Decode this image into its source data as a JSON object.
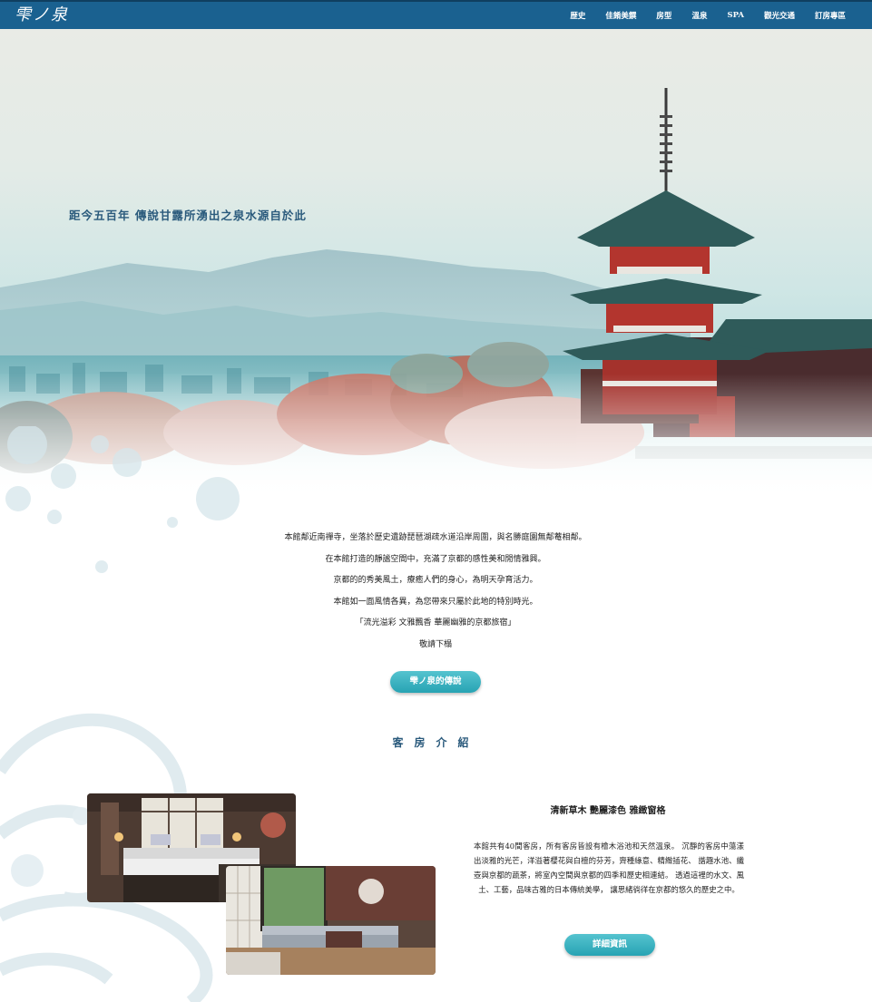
{
  "header": {
    "logo": "雫ノ泉",
    "nav": [
      "歴史",
      "佳餚美饌",
      "房型",
      "溫泉",
      "SPA",
      "觀光交通",
      "訂房專區"
    ]
  },
  "hero": {
    "tagline": "距今五百年  傳說甘露所湧出之泉水源自於此"
  },
  "intro": {
    "lines": [
      "本館鄰近南禪寺，坐落於歷史遺跡琵琶湖疏水道沿岸周圍，與名勝庭園無鄰菴相鄰。",
      "在本館打造的靜謐空間中，充滿了京都的感性美和閒情雅興。",
      "京都的的秀美風土，療癒人們的身心，為明天孕育活力。",
      "本館如一面風情各異，為您帶來只屬於此地的特別時光。",
      "「流光溢彩 文雅飄香 華麗幽雅的京都旅宿」",
      "敬請下榻"
    ],
    "button": "雫ノ泉的傳說"
  },
  "rooms": {
    "section_title": "客房介紹",
    "heading": "清新草木 艷麗漆色 雅緻窗格",
    "description": "本館共有40間客房，所有客房皆設有檜木浴池和天然溫泉。 沉靜的客房中蕩漾出淡雅的光芒，洋溢著櫻花與白檀的芬芳，齊種綠意、精緻插花、 諧趣水池、纖壺與京都的蔬茶，將室內空間與京都的四季和歷史相連結。 透過這裡的水文、風土、工藝，品味古雅的日本傳統美學， 讓思緒徜徉在京都的悠久的歷史之中。",
    "button": "詳細資訊"
  },
  "colors": {
    "nav_bg": "#1a6190",
    "accent_text": "#2a5a7c",
    "button": "#27a3b3"
  }
}
